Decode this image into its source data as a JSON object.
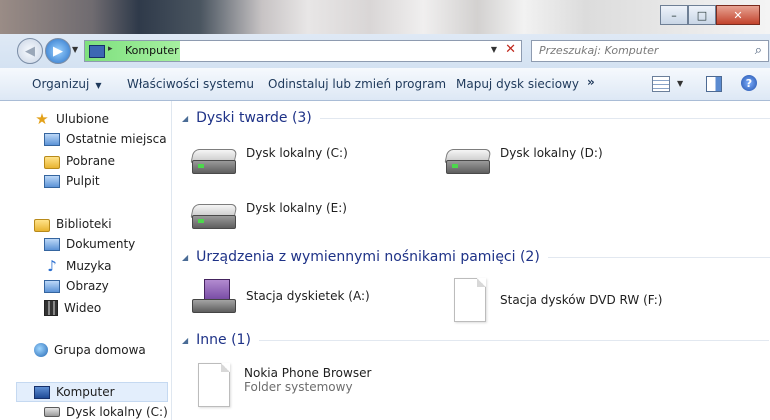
{
  "window": {
    "minimize": "–",
    "maximize": "□",
    "close": "✕"
  },
  "address": {
    "location": "Komputer",
    "search_placeholder": "Przeszukaj: Komputer"
  },
  "toolbar": {
    "organize": "Organizuj",
    "system_properties": "Właściwości systemu",
    "uninstall": "Odinstaluj lub zmień program",
    "map_drive": "Mapuj dysk sieciowy",
    "more": "»",
    "help": "?"
  },
  "sidebar": {
    "favorites": "Ulubione",
    "recent": "Ostatnie miejsca",
    "downloads": "Pobrane",
    "desktop": "Pulpit",
    "libraries": "Biblioteki",
    "documents": "Dokumenty",
    "music": "Muzyka",
    "pictures": "Obrazy",
    "videos": "Wideo",
    "homegroup": "Grupa domowa",
    "computer": "Komputer",
    "local_disk_c": "Dysk lokalny (C:)"
  },
  "groups": {
    "hard_drives": "Dyski twarde (3)",
    "removable": "Urządzenia z wymiennymi nośnikami pamięci (2)",
    "other": "Inne (1)"
  },
  "items": {
    "disk_c": "Dysk lokalny (C:)",
    "disk_d": "Dysk lokalny (D:)",
    "disk_e": "Dysk lokalny (E:)",
    "floppy": "Stacja dyskietek (A:)",
    "dvd": "Stacja dysków DVD RW (F:)",
    "nokia_name": "Nokia Phone Browser",
    "nokia_type": "Folder systemowy"
  },
  "icons": {
    "address_chevron": "▸",
    "dropdown": "▼",
    "clear": "✕",
    "search": "⌕",
    "collapse": "◢",
    "back": "◀",
    "forward": "▶"
  }
}
